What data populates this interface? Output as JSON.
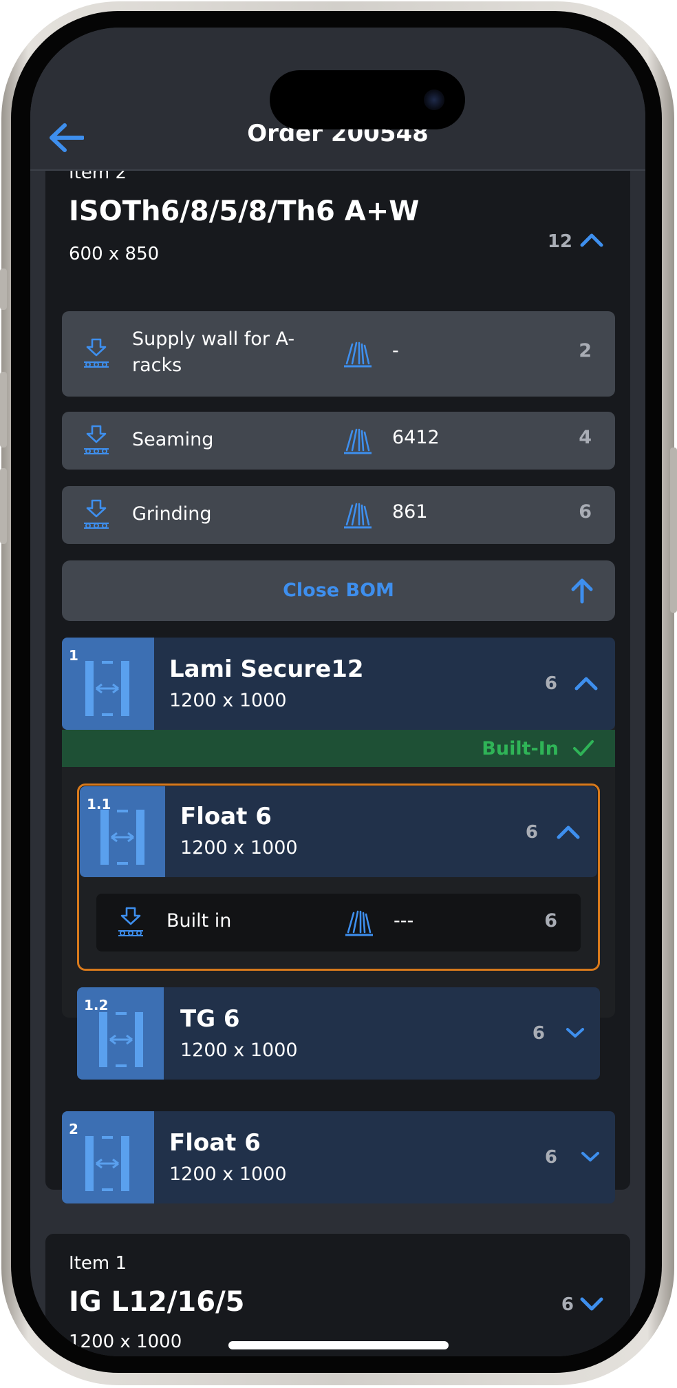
{
  "header": {
    "title": "Order 200548"
  },
  "item2": {
    "label": "Item 2",
    "title": "ISOTh6/8/5/8/Th6 A+W",
    "dimensions": "600 x 850",
    "qty": "12",
    "bom_rows": [
      {
        "name": "Supply wall for A-racks",
        "machine": "-",
        "qty": "2"
      },
      {
        "name": "Seaming",
        "machine": "6412",
        "qty": "4"
      },
      {
        "name": "Grinding",
        "machine": "861",
        "qty": "6"
      }
    ],
    "close_bom_label": "Close BOM"
  },
  "components": [
    {
      "number": "1",
      "name": "Lami Secure12",
      "dimensions": "1200 x 1000",
      "qty": "6",
      "status": "Built-In"
    },
    {
      "number": "1.1",
      "name": "Float 6",
      "dimensions": "1200 x 1000",
      "qty": "6",
      "sub_row": {
        "name": "Built in",
        "machine": "---",
        "qty": "6"
      }
    },
    {
      "number": "1.2",
      "name": "TG 6",
      "dimensions": "1200 x 1000",
      "qty": "6"
    },
    {
      "number": "2",
      "name": "Float 6",
      "dimensions": "1200 x 1000",
      "qty": "6"
    }
  ],
  "item1": {
    "label": "Item 1",
    "title": "IG L12/16/5",
    "dimensions": "1200 x 1000",
    "qty": "6"
  },
  "colors": {
    "accent": "#3e8fee",
    "success": "#2fb457",
    "selection": "#d97a1c",
    "thumbnail": "#3c6fb3"
  },
  "icons": {
    "back": "arrow-left-icon",
    "expand": "chevron-up-icon",
    "collapse": "chevron-down-icon",
    "process": "download-process-icon",
    "machine": "machine-icon",
    "check": "check-icon",
    "close_bom": "arrow-up-icon",
    "glass_pane": "glass-pane-icon"
  }
}
